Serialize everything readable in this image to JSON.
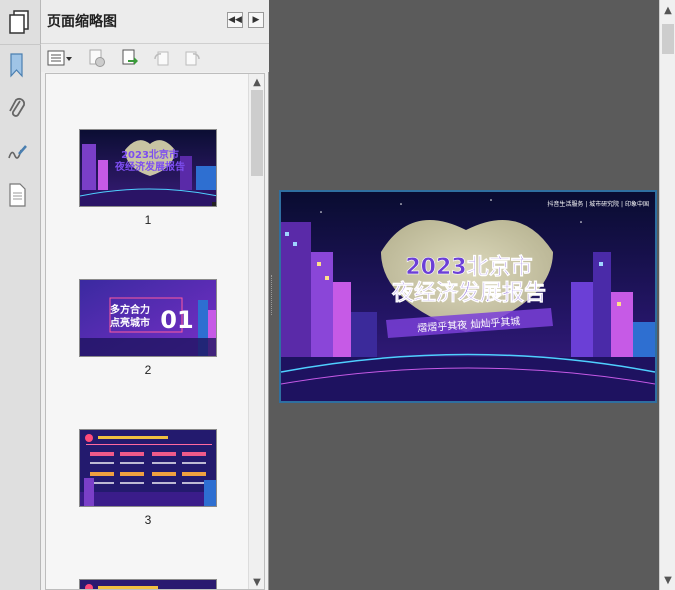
{
  "panel": {
    "title": "页面缩略图",
    "nav_prev": "◀◀",
    "nav_next": "▶"
  },
  "thumbnails": [
    {
      "label": "1",
      "kind": "cover",
      "title_line1": "2023北京市",
      "title_line2": "夜经济发展报告"
    },
    {
      "label": "2",
      "kind": "section",
      "text_line1": "多方合力",
      "text_line2": "点亮城市",
      "number": "01"
    },
    {
      "label": "3",
      "kind": "content"
    }
  ],
  "main_page": {
    "title_line1": "2023北京市",
    "title_line2": "夜经济发展报告",
    "subtitle": "熠熠乎其夜 灿灿乎其城",
    "brands": "抖音生活服务 | 城市研究院 | 印象中国"
  },
  "colors": {
    "accent_purple": "#6b3fd6",
    "dark_sky": "#0c0f3a",
    "moon": "#e8e4b4"
  }
}
